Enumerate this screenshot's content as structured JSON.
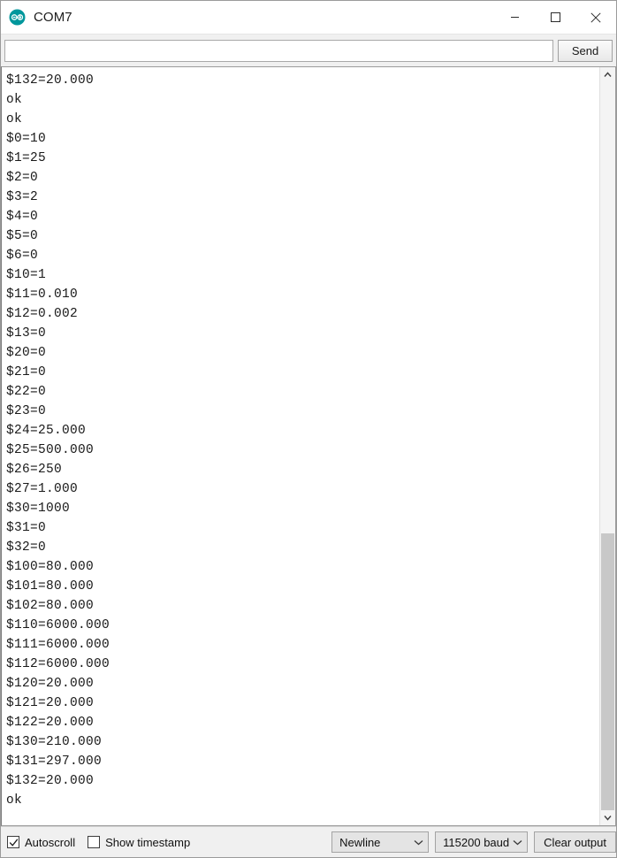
{
  "window": {
    "title": "COM7",
    "app_icon": "arduino-logo-icon",
    "controls": {
      "minimize": "minimize-icon",
      "maximize": "maximize-icon",
      "close": "close-icon"
    }
  },
  "send_bar": {
    "input_value": "",
    "input_placeholder": "",
    "send_label": "Send"
  },
  "output": {
    "lines": [
      "$132=20.000",
      "ok",
      "ok",
      "$0=10",
      "$1=25",
      "$2=0",
      "$3=2",
      "$4=0",
      "$5=0",
      "$6=0",
      "$10=1",
      "$11=0.010",
      "$12=0.002",
      "$13=0",
      "$20=0",
      "$21=0",
      "$22=0",
      "$23=0",
      "$24=25.000",
      "$25=500.000",
      "$26=250",
      "$27=1.000",
      "$30=1000",
      "$31=0",
      "$32=0",
      "$100=80.000",
      "$101=80.000",
      "$102=80.000",
      "$110=6000.000",
      "$111=6000.000",
      "$112=6000.000",
      "$120=20.000",
      "$121=20.000",
      "$122=20.000",
      "$130=210.000",
      "$131=297.000",
      "$132=20.000",
      "ok"
    ]
  },
  "scrollbar": {
    "up_arrow": "chevron-up-icon",
    "down_arrow": "chevron-down-icon",
    "thumb_top_percent": "62%"
  },
  "status_bar": {
    "autoscroll": {
      "label": "Autoscroll",
      "checked": true,
      "check_glyph": "check-icon"
    },
    "show_timestamp": {
      "label": "Show timestamp",
      "checked": false,
      "check_glyph": ""
    },
    "line_ending": {
      "selected": "Newline",
      "arrow": "chevron-down-icon"
    },
    "baud_rate": {
      "selected": "115200 baud",
      "arrow": "chevron-down-icon"
    },
    "clear_output_label": "Clear output"
  },
  "colors": {
    "arduino_teal": "#00979c",
    "titlebar_bg": "#ffffff",
    "chrome_bg": "#f0f0f0",
    "text": "#1a1a1a"
  }
}
